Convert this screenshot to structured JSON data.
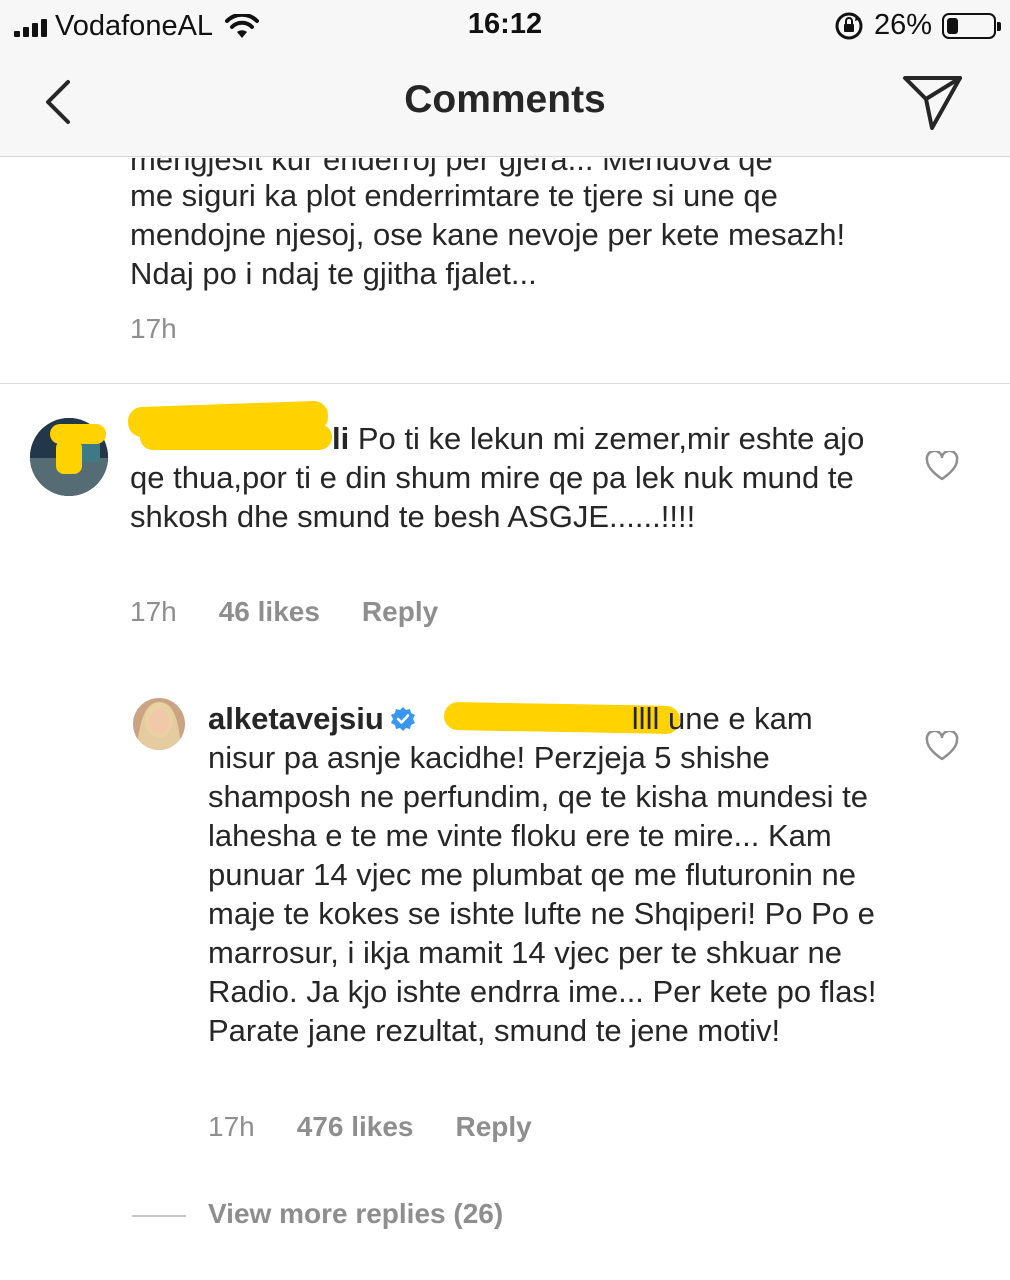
{
  "status_bar": {
    "carrier": "VodafoneAL",
    "time": "16:12",
    "battery_percent": "26%",
    "battery_level": 0.26,
    "icons": [
      "signal-icon",
      "wifi-icon",
      "rotation-lock-icon",
      "battery-icon"
    ]
  },
  "nav": {
    "title": "Comments",
    "back_icon": "chevron-left-icon",
    "share_icon": "paper-plane-icon"
  },
  "caption": {
    "partial_line": "mengjesit kur enderroj per gjera... Mendova qe",
    "text": "me siguri ka plot enderrimtare te tjere si une qe mendojne njesoj, ose kane nevoje per kete mesazh! Ndaj po i ndaj te gjitha fjalet...",
    "time": "17h"
  },
  "comment1": {
    "username_fragment": "li",
    "text": "Po ti ke lekun mi zemer,mir eshte ajo qe thua,por ti e din shum mire qe pa lek nuk mund te shkosh dhe smund te besh ASGJE......!!!!",
    "time": "17h",
    "likes": "46 likes",
    "reply": "Reply"
  },
  "reply1": {
    "username": "alketavejsiu",
    "mention_fragment": "llll",
    "text": "une e kam nisur pa asnje kacidhe! Perzjeja 5 shishe shamposh ne perfundim, qe te kisha mundesi te lahesha e te me vinte floku ere te mire... Kam punuar 14 vjec me plumbat qe me fluturonin ne maje te kokes se ishte lufte ne Shqiperi! Po Po e marrosur, i ikja mamit 14 vjec per te shkuar ne Radio. Ja kjo ishte endrra ime... Per kete po flas! Parate jane rezultat, smund te jene motiv!",
    "time": "17h",
    "likes": "476 likes",
    "reply": "Reply"
  },
  "view_more_replies": "View more replies (26)",
  "colors": {
    "text": "#262626",
    "meta": "#8e8e8e",
    "verified": "#3897f0",
    "redaction": "#ffd200",
    "bar_bg": "#f7f7f7"
  }
}
